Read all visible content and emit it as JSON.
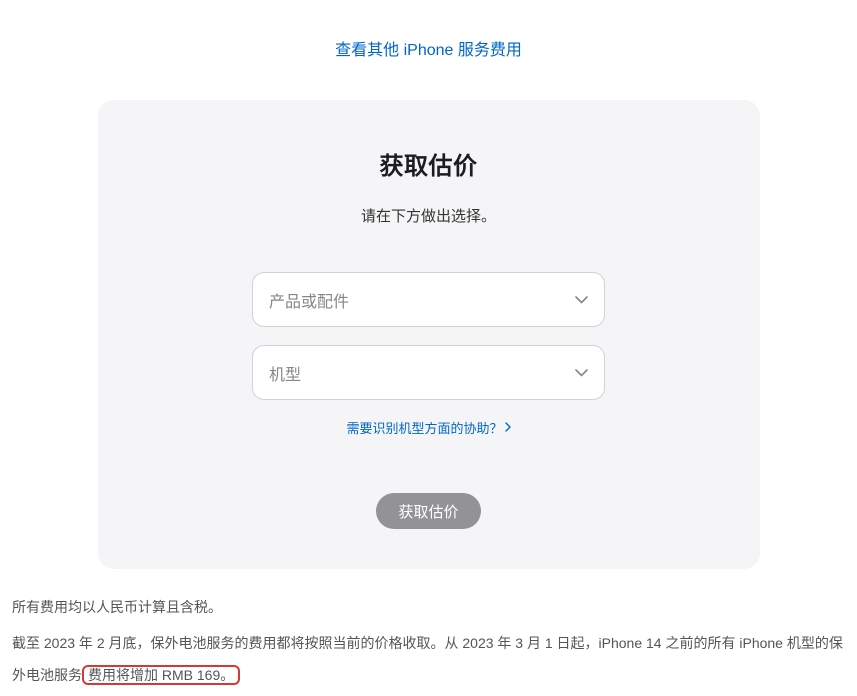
{
  "topLink": "查看其他 iPhone 服务费用",
  "card": {
    "title": "获取估价",
    "subtitle": "请在下方做出选择。",
    "select1Placeholder": "产品或配件",
    "select2Placeholder": "机型",
    "helpLink": "需要识别机型方面的协助？",
    "buttonLabel": "获取估价"
  },
  "footer": {
    "line1": "所有费用均以人民币计算且含税。",
    "line2Prefix": "截至 2023 年 2 月底，保外电池服务的费用都将按照当前的价格收取。从 2023 年 3 月 1 日起，iPhone 14 之前的所有 iPhone 机型的保外电池服务",
    "line2Highlight": "费用将增加 RMB 169。"
  }
}
